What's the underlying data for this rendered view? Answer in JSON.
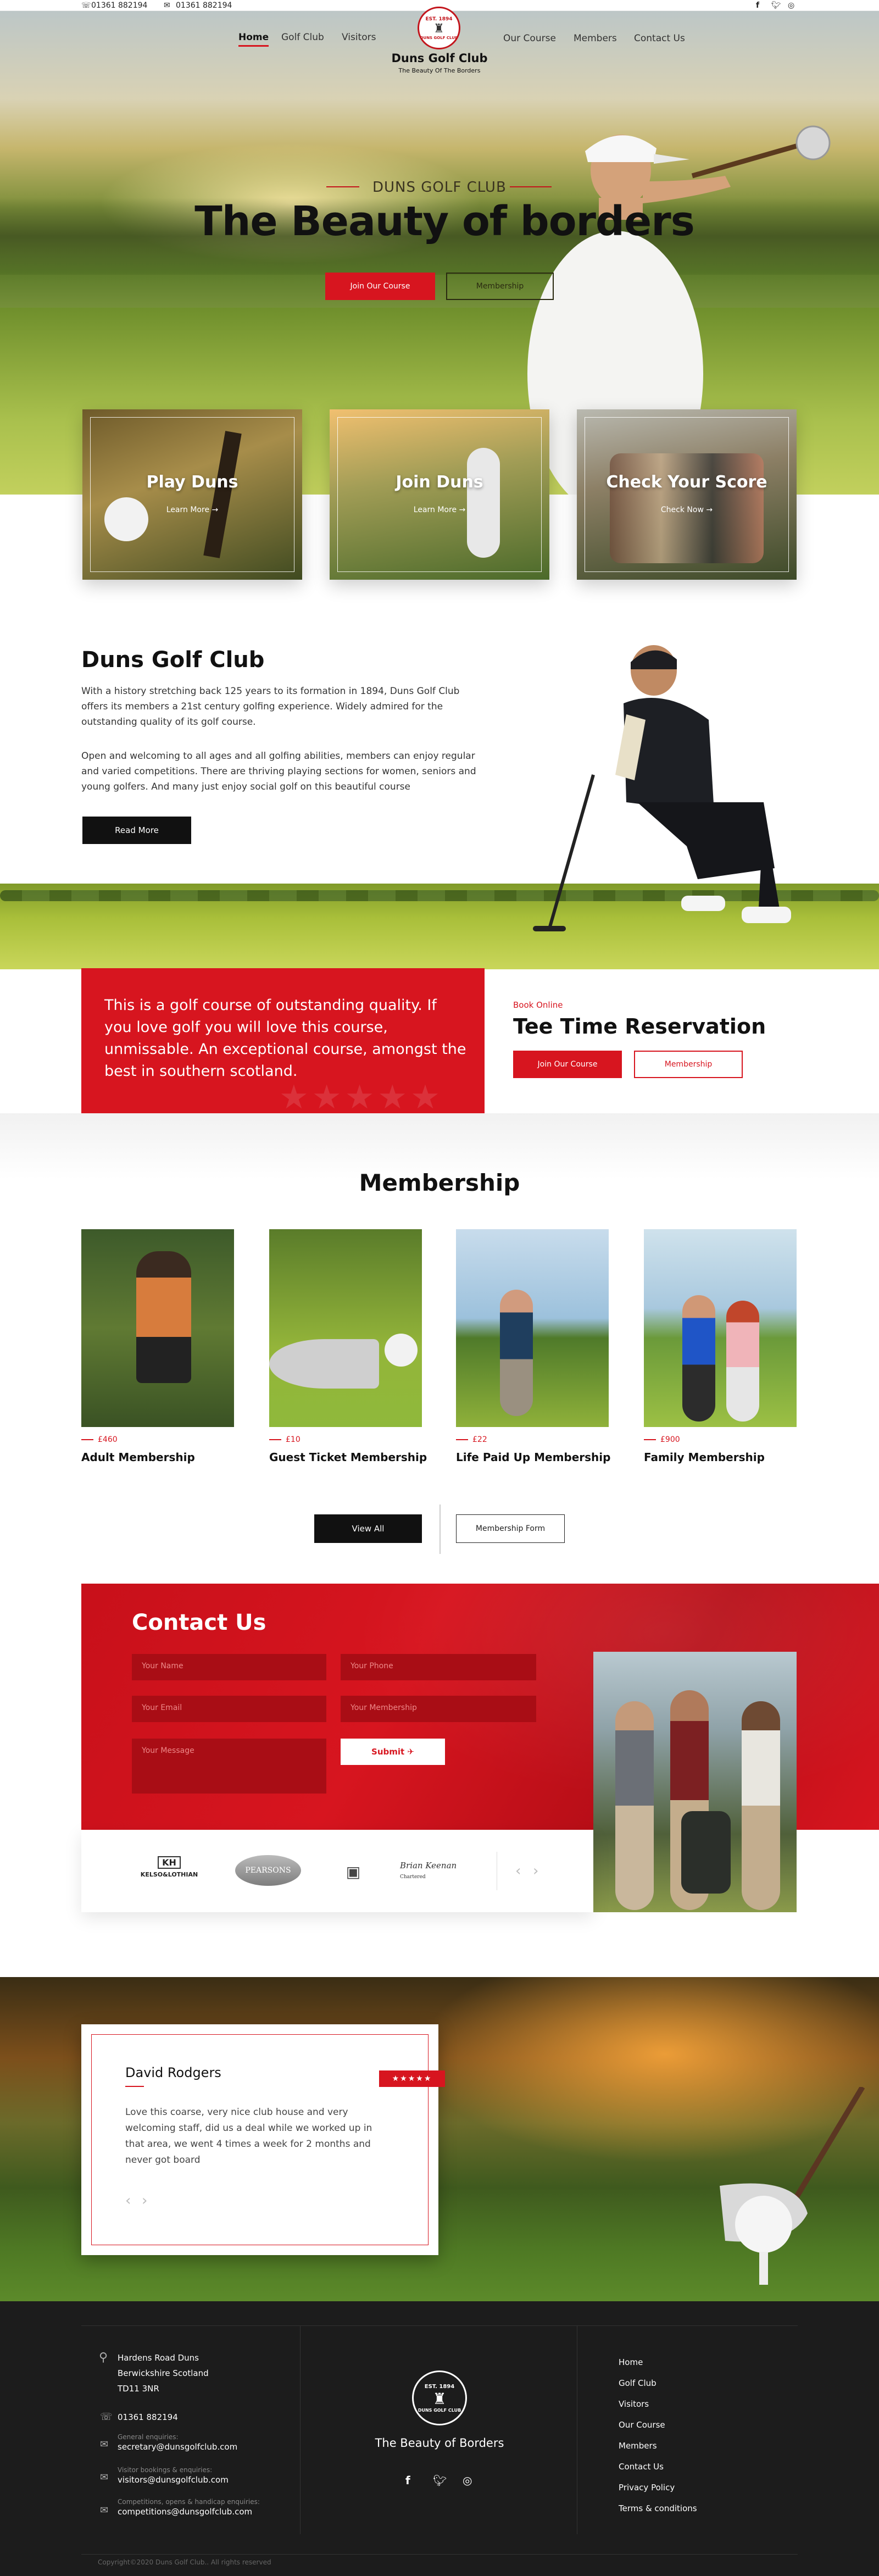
{
  "topbar": {
    "phone": "01361 882194",
    "email_phone": "01361 882194"
  },
  "nav": {
    "items_left": [
      {
        "label": "Home",
        "active": true
      },
      {
        "label": "Golf Club",
        "active": false
      },
      {
        "label": "Visitors",
        "active": false
      }
    ],
    "items_right": [
      {
        "label": "Our Course",
        "active": false
      },
      {
        "label": "Members",
        "active": false
      },
      {
        "label": "Contact Us",
        "active": false
      }
    ],
    "logo": {
      "top": "EST. 1894",
      "bottom": "DUNS GOLF CLUB",
      "name": "Duns Golf Club",
      "tagline": "The Beauty Of The Borders"
    }
  },
  "hero": {
    "kicker": "DUNS GOLF CLUB",
    "title": "The Beauty of borders",
    "btn_join": "Join Our Course",
    "btn_membership": "Membership",
    "cards": [
      {
        "title": "Play Duns",
        "link": "Learn More →"
      },
      {
        "title": "Join Duns",
        "link": "Learn More →"
      },
      {
        "title": "Check Your Score",
        "link": "Check Now →"
      }
    ]
  },
  "about": {
    "title": "Duns Golf Club",
    "p1": "With a history stretching back 125 years to its formation in 1894, Duns Golf Club offers its members a 21st century golfing experience. Widely admired for the outstanding quality of its golf course.",
    "p2": "Open and welcoming to all ages and all golfing abilities, members can enjoy regular and varied competitions. There are thriving playing sections for women, seniors and young golfers. And many just enjoy social golf on this beautiful course",
    "btn": "Read More"
  },
  "reservation": {
    "quote": "This is a golf course of outstanding quality. If you love golf you will love this course, unmissable. An exceptional course, amongst the best in southern scotland.",
    "kicker": "Book Online",
    "title": "Tee Time Reservation",
    "btn_join": "Join Our Course",
    "btn_membership": "Membership"
  },
  "membership": {
    "title": "Membership",
    "cards": [
      {
        "price": "£460",
        "title": "Adult Membership"
      },
      {
        "price": "£10",
        "title": "Guest Ticket Membership"
      },
      {
        "price": "£22",
        "title": "Life Paid Up Membership"
      },
      {
        "price": "£900",
        "title": "Family Membership"
      }
    ],
    "btn_view_all": "View All",
    "btn_form": "Membership Form"
  },
  "contact": {
    "title": "Contact Us",
    "placeholders": {
      "name": "Your Name",
      "phone": "Your Phone",
      "email": "Your Email",
      "membership": "Your Membership",
      "message": "Your Message"
    },
    "submit": "Submit ✈",
    "partners": [
      {
        "label": "KH",
        "sub": "KELSO&LOTHIAN"
      },
      {
        "label": "PEARSONS",
        "sub": ""
      },
      {
        "label": "",
        "sub": ""
      },
      {
        "label": "Brian Keenan",
        "sub": "Chartered"
      }
    ]
  },
  "testimonial": {
    "name": "David Rodgers",
    "stars": "★★★★★",
    "text": "Love this coarse, very nice club house and very welcoming staff, did us a deal while we worked up in that area, we went 4 times a week for 2 months and never got board"
  },
  "footer": {
    "address_line1": "Hardens Road Duns",
    "address_line2": "Berwickshire Scotland",
    "address_line3": "TD11 3NR",
    "phone": "01361 882194",
    "general_label": "General enquiries:",
    "general_email": "secretary@dunsgolfclub.com",
    "visitor_label": "Visitor bookings & enquiries:",
    "visitor_email": "visitors@dunsgolfclub.com",
    "comp_label": "Competitions, opens & handicap enquiries:",
    "comp_email": "competitions@dunsgolfclub.com",
    "logo_top": "EST. 1894",
    "logo_bottom": "DUNS GOLF CLUB",
    "tagline": "The Beauty of Borders",
    "links": [
      "Home",
      "Golf Club",
      "Visitors",
      "Our Course",
      "Members",
      "Contact Us",
      "Privacy Policy",
      "Terms & conditions"
    ],
    "copyright": "Copyright©2020 Duns Golf Club.. All rights reserved"
  }
}
